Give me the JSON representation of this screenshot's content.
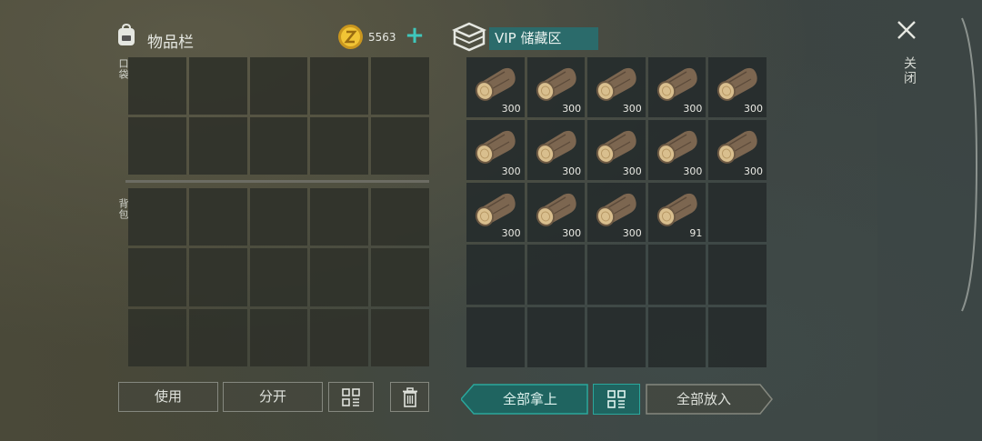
{
  "inventory": {
    "title": "物品栏",
    "coins": "5563",
    "pocket_label": "口袋",
    "backpack_label": "背包",
    "pocket_slots": 10,
    "backpack_slots": 15
  },
  "storage": {
    "title": "VIP 储藏区",
    "items": [
      {
        "name": "wood-log",
        "qty": "300"
      },
      {
        "name": "wood-log",
        "qty": "300"
      },
      {
        "name": "wood-log",
        "qty": "300"
      },
      {
        "name": "wood-log",
        "qty": "300"
      },
      {
        "name": "wood-log",
        "qty": "300"
      },
      {
        "name": "wood-log",
        "qty": "300"
      },
      {
        "name": "wood-log",
        "qty": "300"
      },
      {
        "name": "wood-log",
        "qty": "300"
      },
      {
        "name": "wood-log",
        "qty": "300"
      },
      {
        "name": "wood-log",
        "qty": "300"
      },
      {
        "name": "wood-log",
        "qty": "300"
      },
      {
        "name": "wood-log",
        "qty": "300"
      },
      {
        "name": "wood-log",
        "qty": "300"
      },
      {
        "name": "wood-log",
        "qty": "91"
      }
    ],
    "total_slots": 25
  },
  "buttons": {
    "use": "使用",
    "split": "分开",
    "take_all": "全部拿上",
    "put_all": "全部放入"
  },
  "close_label": "关闭",
  "colors": {
    "accent": "#3fc7bb",
    "storage_title_bg": "#2b6b6b",
    "take_all_bg": "#1f6460"
  }
}
